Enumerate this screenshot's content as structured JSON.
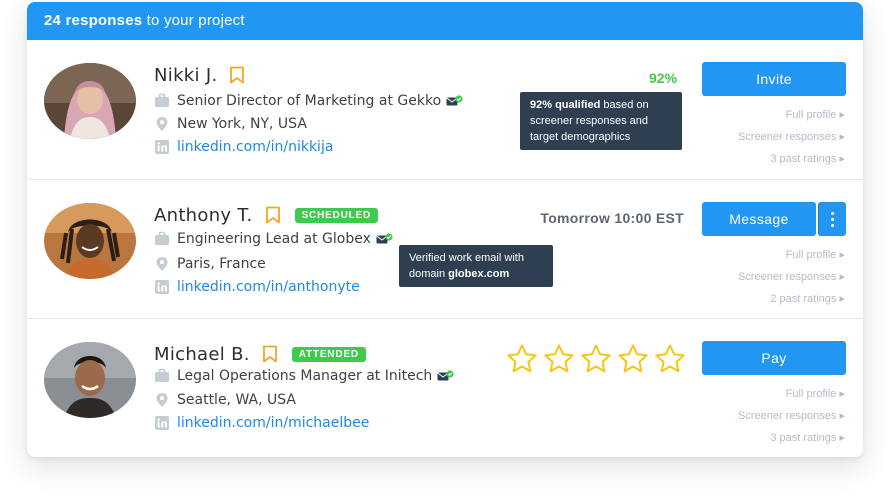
{
  "header": {
    "count": "24 responses",
    "suffix": " to your project"
  },
  "icons": {
    "briefcase": "briefcase-icon",
    "location": "map-pin-icon",
    "linkedin": "linkedin-icon",
    "bookmark": "bookmark-icon",
    "verified": "verified-email-icon",
    "star": "star-icon"
  },
  "colors": {
    "primary": "#2196f3",
    "success": "#3fc94e",
    "bookmark": "#f5a623",
    "star": "#f5c518",
    "tooltip": "#2f3f52"
  },
  "respondents": [
    {
      "name": "Nikki J.",
      "title": "Senior Director of Marketing at Gekko",
      "location": "New York, NY, USA",
      "linkedin": "linkedin.com/in/nikkija",
      "qualified_percent": "92%",
      "tooltip_bold": "92% qualified",
      "tooltip_rest": " based on screener responses and target demographics",
      "button": "Invite",
      "links": [
        "Full profile ▸",
        "Screener responses ▸",
        "3 past ratings ▸"
      ]
    },
    {
      "name": "Anthony T.",
      "badge": "SCHEDULED",
      "title": "Engineering Lead at Globex",
      "location": "Paris, France",
      "linkedin": "linkedin.com/in/anthonyte",
      "schedule": "Tomorrow 10:00 EST",
      "tooltip_text": "Verified work email with domain ",
      "tooltip_bold": "globex.com",
      "button": "Message",
      "links": [
        "Full profile ▸",
        "Screener responses ▸",
        "2 past ratings ▸"
      ]
    },
    {
      "name": "Michael B.",
      "badge": "ATTENDED",
      "title": "Legal Operations Manager at Initech",
      "location": "Seattle, WA, USA",
      "linkedin": "linkedin.com/in/michaelbee",
      "rating": 0,
      "rating_max": 5,
      "button": "Pay",
      "links": [
        "Full profile ▸",
        "Screener responses ▸",
        "3 past ratings ▸"
      ]
    }
  ]
}
